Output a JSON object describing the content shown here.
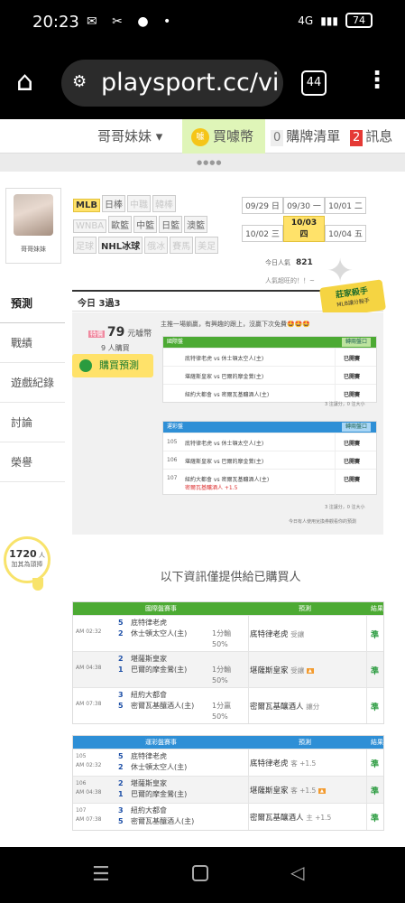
{
  "status": {
    "time": "20:23",
    "battery": "74",
    "network": "4G"
  },
  "browser": {
    "url": "playsport.cc/vi",
    "tab_count": "44"
  },
  "topnav": {
    "user_label": "哥哥妹妹 ▾",
    "buy_coin_label": "買噱幣",
    "list_count": "0",
    "list_label": "購牌清單",
    "msg_count": "2",
    "msg_label": "訊息"
  },
  "sidebar": {
    "user_name": "哥哥妹妹",
    "tabs": [
      "預測",
      "戰績",
      "遊戲紀錄",
      "討論",
      "榮譽"
    ],
    "fans_count": "1720",
    "fans_unit": "人",
    "fans_note": "加其為頭捧"
  },
  "leagues": {
    "row1": [
      "MLB",
      "日棒",
      "中職",
      "韓棒"
    ],
    "row2": [
      "WNBA",
      "歐籃",
      "中籃",
      "日籃",
      "澳籃"
    ],
    "row3": [
      "足球",
      "NHL冰球",
      "俄冰",
      "賽馬",
      "美足"
    ]
  },
  "dates": [
    {
      "date": "09/29",
      "day": "日"
    },
    {
      "date": "09/30",
      "day": "一"
    },
    {
      "date": "10/01",
      "day": "二"
    },
    {
      "date": "10/02",
      "day": "三"
    },
    {
      "date": "10/03",
      "day": "四"
    },
    {
      "date": "10/04",
      "day": "五"
    }
  ],
  "popularity": {
    "label": "今日人氣",
    "value": "821",
    "note": "人氣超旺的！！~"
  },
  "master_badge": {
    "title": "莊家殺手",
    "sub": "MLB讓分殺手"
  },
  "today": {
    "title": "今日 3過3"
  },
  "pred_box": {
    "price_tag": "特價",
    "price": "79",
    "price_unit": "元噱幣",
    "buyers": "9 人購買",
    "buy_button": "購買預測",
    "promo": "主推一場躺贏，有興趣的跟上，沒贏下次免費🤩🤩🤩",
    "note_left": "3 注讓分，0 注大小",
    "note_right": "3 注讓分，0 注大小",
    "footer": "今日有人使用兌換券觀看你的預測"
  },
  "mini_intl": {
    "title": "國際盤",
    "switch": "轉兩盤口",
    "rows": [
      {
        "away": "底特律老虎",
        "home": "休士頓太空人(主)",
        "res": "已開賽"
      },
      {
        "away": "堪薩斯皇家",
        "home": "巴爾的摩金鶯(主)",
        "res": "已開賽"
      },
      {
        "away": "紐約大都會",
        "home": "密爾瓦基釀酒人(主)",
        "res": "已開賽"
      }
    ]
  },
  "mini_tw": {
    "title": "運彩盤",
    "switch": "轉兩盤口",
    "rows": [
      {
        "num": "105",
        "away": "底特律老虎",
        "home": "休士頓太空人(主)",
        "res": "已開賽"
      },
      {
        "num": "106",
        "away": "堪薩斯皇家",
        "home": "巴爾的摩金鶯(主)",
        "res": "已開賽"
      },
      {
        "num": "107",
        "away": "紐約大都會",
        "home": "密爾瓦基釀酒人(主)",
        "extra": "密爾瓦基釀酒人 +1.5",
        "res": "已開賽"
      }
    ]
  },
  "info_title": "以下資訊僅提供給已購買人",
  "table_intl": {
    "headers": [
      "國際盤賽事",
      "預測",
      "結果"
    ],
    "rows": [
      {
        "time": "AM 02:32",
        "s1": "5",
        "s2": "2",
        "away": "底特律老虎",
        "home": "休士頓太空人(主)",
        "line": "1分輸",
        "pct": "50%",
        "pick": "底特律老虎",
        "pick_note": "受讓",
        "result": "準"
      },
      {
        "time": "AM 04:38",
        "s1": "2",
        "s2": "1",
        "away": "堪薩斯皇家",
        "home": "巴爾的摩金鶯(主)",
        "line": "1分輸",
        "pct": "50%",
        "pick": "堪薩斯皇家",
        "pick_note": "受讓",
        "result": "準"
      },
      {
        "time": "AM 07:38",
        "s1": "3",
        "s2": "5",
        "away": "紐約大都會",
        "home": "密爾瓦基釀酒人(主)",
        "line": "1分贏",
        "pct": "50%",
        "pick": "密爾瓦基釀酒人",
        "pick_note": "讓分",
        "result": "準"
      }
    ]
  },
  "table_tw": {
    "headers": [
      "運彩盤賽事",
      "預測",
      "結果"
    ],
    "rows": [
      {
        "num": "105",
        "time": "AM 02:32",
        "s1": "5",
        "s2": "2",
        "away": "底特律老虎",
        "home": "休士頓太空人(主)",
        "pick": "底特律老虎",
        "pick_note": "客 +1.5",
        "result": "準"
      },
      {
        "num": "106",
        "time": "AM 04:38",
        "s1": "2",
        "s2": "1",
        "away": "堪薩斯皇家",
        "home": "巴爾的摩金鶯(主)",
        "pick": "堪薩斯皇家",
        "pick_note": "客 +1.5",
        "result": "準"
      },
      {
        "num": "107",
        "time": "AM 07:38",
        "s1": "3",
        "s2": "5",
        "away": "紐約大都會",
        "home": "密爾瓦基釀酒人(主)",
        "pick": "密爾瓦基釀酒人",
        "pick_note": "主 +1.5",
        "result": "準"
      }
    ]
  },
  "colors": {
    "green": "#4caa33",
    "blue": "#2e8fd6",
    "yellow": "#ffe26a",
    "result_green": "#2a9b3f"
  }
}
